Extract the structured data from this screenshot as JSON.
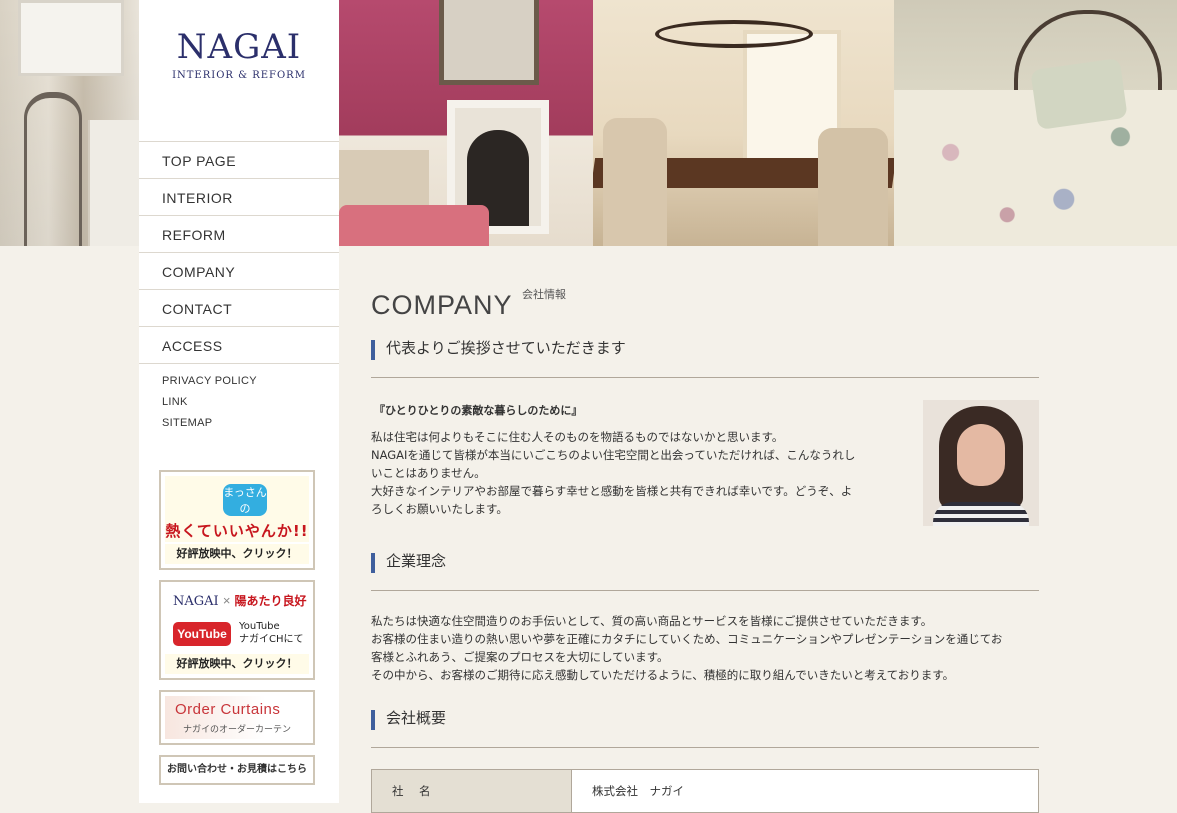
{
  "logo": {
    "main": "NAGAI",
    "sub": "INTERIOR & REFORM"
  },
  "nav": [
    {
      "label": "TOP PAGE"
    },
    {
      "label": "INTERIOR"
    },
    {
      "label": "REFORM"
    },
    {
      "label": "COMPANY"
    },
    {
      "label": "CONTACT"
    },
    {
      "label": "ACCESS"
    }
  ],
  "subnav": [
    {
      "label": "PRIVACY POLICY"
    },
    {
      "label": "LINK"
    },
    {
      "label": "SITEMAP"
    }
  ],
  "banners": {
    "b1": {
      "badge": "まっさんの",
      "title": "熱くていいやんか!!",
      "caption": "好評放映中、クリック！"
    },
    "b2": {
      "brand": "NAGAI",
      "cross": "×",
      "show": "陽あたり良好",
      "yt": "YouTube",
      "yt_line1": "YouTube",
      "yt_line2": "ナガイCHにて",
      "caption": "好評放映中、クリック！"
    },
    "b3": {
      "title": "Order Curtains",
      "sub": "ナガイのオーダーカーテン"
    },
    "b4": {
      "label": "お問い合わせ・お見積はこちら"
    }
  },
  "page": {
    "title": "COMPANY",
    "subtitle": "会社情報"
  },
  "sections": {
    "greeting": {
      "heading": "代表よりご挨拶させていただきます",
      "title": "『ひとりひとりの素敵な暮らしのために』",
      "lines": [
        "私は住宅は何よりもそこに住む人そのものを物語るものではないかと思います。",
        "NAGAIを通じて皆様が本当にいごこちのよい住宅空間と出会っていただければ、こんなうれし",
        "いことはありません。",
        "大好きなインテリアやお部屋で暮らす幸せと感動を皆様と共有できれば幸いです。どうぞ、よ",
        "ろしくお願いいたします。"
      ]
    },
    "philosophy": {
      "heading": "企業理念",
      "lines": [
        "私たちは快適な住空間造りのお手伝いとして、質の高い商品とサービスを皆様にご提供させていただきます。",
        "お客様の住まい造りの熱い思いや夢を正確にカタチにしていくため、コミュニケーションやプレゼンテーションを通じてお",
        "客様とふれあう、ご提案のプロセスを大切にしています。",
        "その中から、お客様のご期待に応え感動していただけるように、積極的に取り組んでいきたいと考えております。"
      ]
    },
    "overview": {
      "heading": "会社概要",
      "rows": [
        {
          "key": "社　名",
          "value": "株式会社　ナガイ"
        }
      ]
    }
  },
  "colors": {
    "accent_bar": "#3f5f9d",
    "logo": "#2b2f6b",
    "background": "#f4f1ea"
  }
}
